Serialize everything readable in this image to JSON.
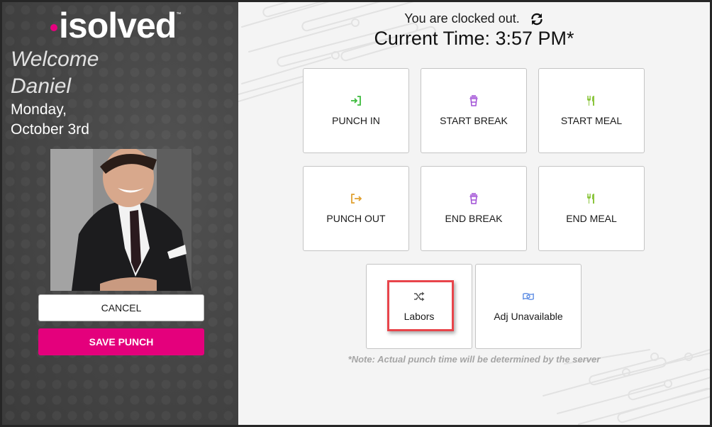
{
  "sidebar": {
    "logo": {
      "text": "isolved",
      "tm": "™",
      "dot_color": "#e6007e"
    },
    "welcome_line1": "Welcome",
    "welcome_line2": "Daniel",
    "date_line1": "Monday,",
    "date_line2": "October 3rd",
    "photo_alt": "Employee photo",
    "cancel_label": "CANCEL",
    "save_label": "SAVE PUNCH",
    "accent_color": "#e4007c"
  },
  "main": {
    "status_text": "You are clocked out.",
    "current_time_label": "Current Time: 3:57 PM*",
    "tiles": [
      {
        "label": "PUNCH IN",
        "icon": "punch-in-icon",
        "color": "#3dbb3d"
      },
      {
        "label": "START BREAK",
        "icon": "coffee-cup-icon",
        "color": "#a04fd6"
      },
      {
        "label": "START MEAL",
        "icon": "utensils-icon",
        "color": "#8cc63f"
      },
      {
        "label": "PUNCH OUT",
        "icon": "punch-out-icon",
        "color": "#e0a030"
      },
      {
        "label": "END BREAK",
        "icon": "coffee-cup-icon",
        "color": "#a04fd6"
      },
      {
        "label": "END MEAL",
        "icon": "utensils-icon",
        "color": "#8cc63f"
      },
      {
        "label": "Labors",
        "icon": "shuffle-icon",
        "color": "#555555"
      },
      {
        "label": "Adj Unavailable",
        "icon": "money-bill-icon",
        "color": "#4a7fe0"
      }
    ],
    "note": "*Note: Actual punch time will be determined by the server",
    "highlight_color": "#e8454b"
  }
}
